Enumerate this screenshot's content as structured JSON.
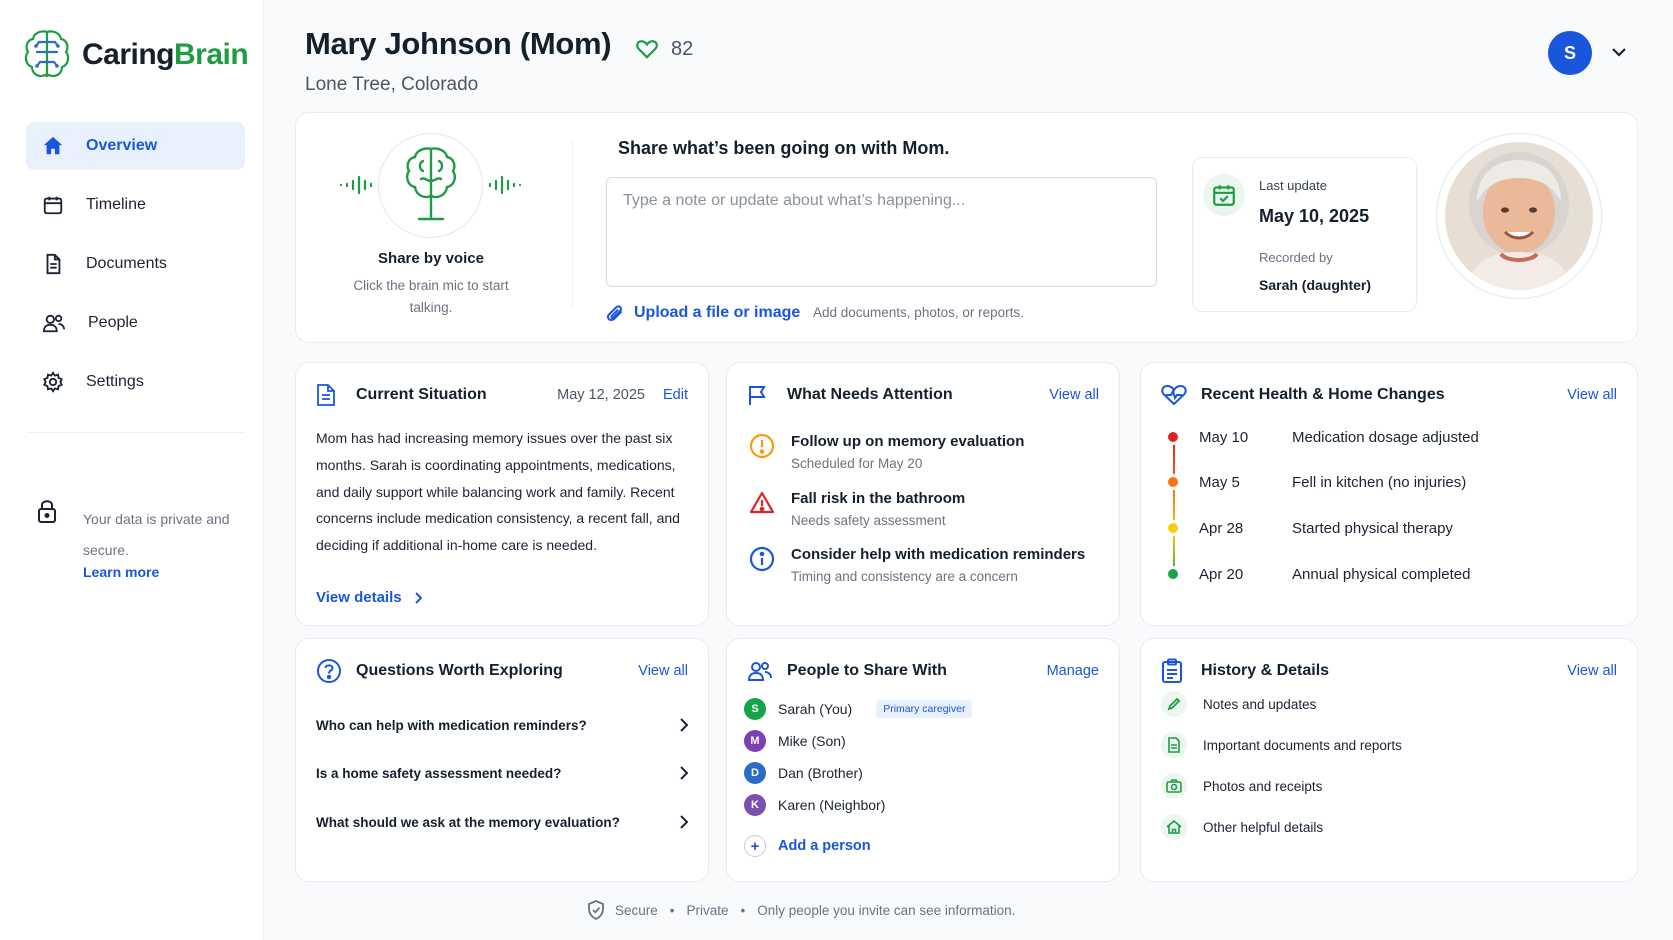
{
  "app": {
    "brand_part1": "Caring",
    "brand_part2": "Brain",
    "brand_color": "#1f9b45",
    "accent": "#1a56db"
  },
  "sidebar": {
    "items": [
      {
        "label": "Overview",
        "icon": "home-icon",
        "active": true
      },
      {
        "label": "Timeline",
        "icon": "calendar-icon"
      },
      {
        "label": "Documents",
        "icon": "document-icon"
      },
      {
        "label": "People",
        "icon": "people-icon"
      },
      {
        "label": "Settings",
        "icon": "gear-icon"
      }
    ],
    "privacy_text": "Your data is private and secure.",
    "learn_more": "Learn more"
  },
  "header": {
    "name": "Mary Johnson (Mom)",
    "score": "82",
    "location": "Lone Tree, Colorado",
    "user_initial": "S"
  },
  "share": {
    "voice_title": "Share by voice",
    "voice_sub": "Click the brain mic to start talking.",
    "title": "Share what’s been going on with Mom.",
    "placeholder": "Type a note or update about what’s happening...",
    "upload_label": "Upload a file or image",
    "upload_hint": "Add documents, photos, or reports.",
    "last_update_label": "Last update",
    "last_update_date": "May 10, 2025",
    "recorded_by_label": "Recorded by",
    "recorded_by": "Sarah (daughter)"
  },
  "current_situation": {
    "title": "Current Situation",
    "date": "May 12, 2025",
    "edit": "Edit",
    "body": "Mom has had increasing memory issues over the past six months. Sarah is coordinating appointments, medications, and daily support while balancing work and family. Recent concerns include medication consistency, a recent fall, and deciding if additional in-home care is needed.",
    "view_details": "View details"
  },
  "attention": {
    "title": "What Needs Attention",
    "view_all": "View all",
    "items": [
      {
        "title": "Follow up on memory evaluation",
        "sub": "Scheduled for May 20",
        "icon": "warning-circle-icon",
        "color": "#f59e0b"
      },
      {
        "title": "Fall risk in the bathroom",
        "sub": "Needs safety assessment",
        "icon": "warning-triangle-icon",
        "color": "#dc2626"
      },
      {
        "title": "Consider help with medication reminders",
        "sub": "Timing and consistency are a concern",
        "icon": "info-icon",
        "color": "#1a56db"
      }
    ]
  },
  "health": {
    "title": "Recent Health & Home Changes",
    "view_all": "View all",
    "items": [
      {
        "date": "May 10",
        "desc": "Medication dosage adjusted",
        "color": "#dc2626"
      },
      {
        "date": "May 5",
        "desc": "Fell in kitchen (no injuries)",
        "color": "#f97316"
      },
      {
        "date": "Apr 28",
        "desc": "Started physical therapy",
        "color": "#facc15"
      },
      {
        "date": "Apr 20",
        "desc": "Annual physical completed",
        "color": "#16a34a"
      }
    ]
  },
  "questions": {
    "title": "Questions Worth Exploring",
    "view_all": "View all",
    "items": [
      "Who can help with medication reminders?",
      "Is a home safety assessment needed?",
      "What should we ask at the memory evaluation?"
    ]
  },
  "people": {
    "title": "People to Share With",
    "manage": "Manage",
    "items": [
      {
        "initial": "S",
        "name": "Sarah (You)",
        "badge": "Primary caregiver",
        "color": "#16a34a"
      },
      {
        "initial": "M",
        "name": "Mike (Son)",
        "color": "#7e3fb0"
      },
      {
        "initial": "D",
        "name": "Dan (Brother)",
        "color": "#2b6cc4"
      },
      {
        "initial": "K",
        "name": "Karen (Neighbor)",
        "color": "#7a4fae"
      }
    ],
    "add": "Add a person"
  },
  "history": {
    "title": "History & Details",
    "view_all": "View all",
    "items": [
      {
        "label": "Notes and updates",
        "icon": "pencil-icon"
      },
      {
        "label": "Important documents and reports",
        "icon": "document-icon"
      },
      {
        "label": "Photos and receipts",
        "icon": "camera-icon"
      },
      {
        "label": "Other helpful details",
        "icon": "home-icon"
      }
    ]
  },
  "footer": {
    "secure": "Secure",
    "private": "Private",
    "note": "Only people you invite can see information."
  }
}
